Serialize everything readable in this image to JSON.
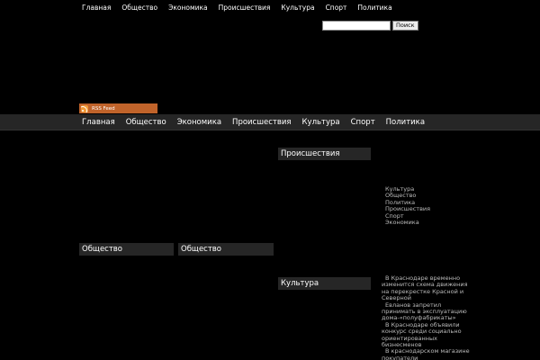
{
  "top_nav": [
    "Главная",
    "Общество",
    "Экономика",
    "Происшествия",
    "Культура",
    "Спорт",
    "Политика"
  ],
  "search": {
    "value": "",
    "button_label": "Поиск"
  },
  "rss": {
    "label": "RSS Feed",
    "icon": "rss-icon"
  },
  "main_nav": [
    "Главная",
    "Общество",
    "Экономика",
    "Происшествия",
    "Культура",
    "Спорт",
    "Политика"
  ],
  "sections": {
    "incidents_title": "Происшествия",
    "society_title_1": "Общество",
    "society_title_2": "Общество",
    "culture_title": "Культура"
  },
  "categories": [
    "Культура",
    "Общество",
    "Политика",
    "Происшествия",
    "Спорт",
    "Экономика"
  ],
  "news": [
    "В Краснодаре временно изменится схема движения на перекрестке Красной и Северной",
    "Евланов запретил принимать в эксплуатацию дома-«полуфабрикаты»",
    "В Краснодаре объявили конкурс среди социально ориентированных бизнесменов",
    "В краснодарском магазине покупатели"
  ]
}
